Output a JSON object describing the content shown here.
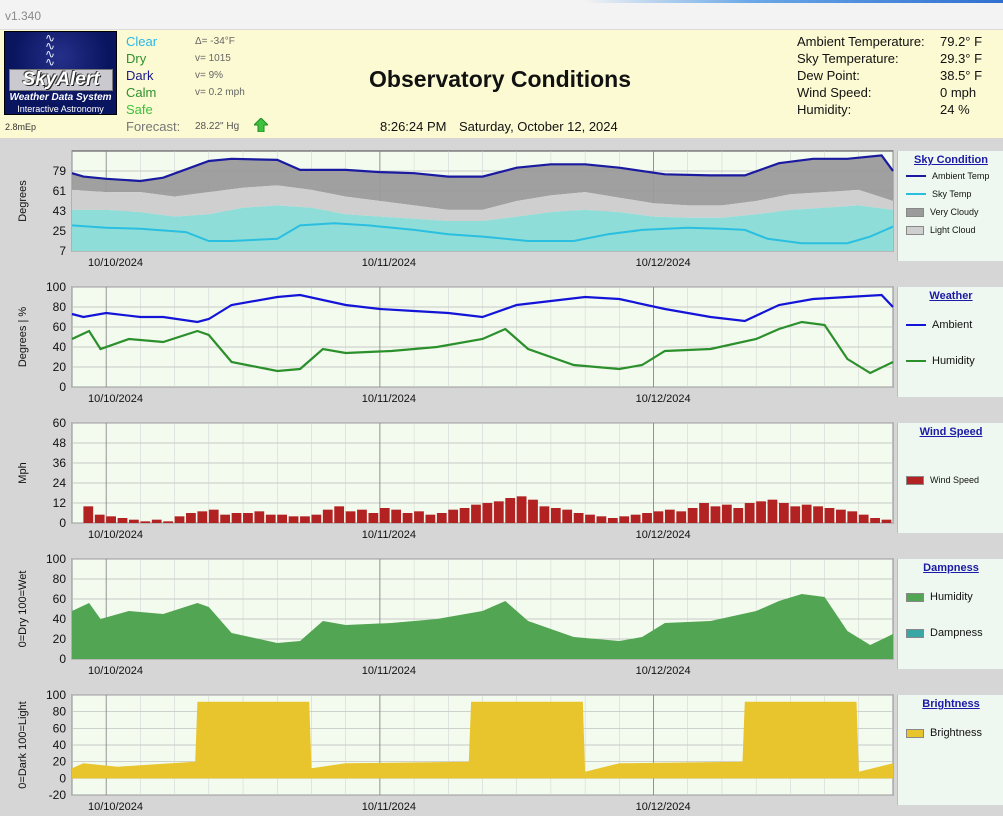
{
  "app": {
    "version": "v1.340"
  },
  "logo": {
    "brand": "SkyAlert",
    "tagline": "Weather Data System",
    "subtitle": "Interactive Astronomy",
    "caption": "2.8mEp"
  },
  "conditions": [
    {
      "label": "Clear",
      "value": "Δ= -34°F",
      "color": "#29b6e8"
    },
    {
      "label": "Dry",
      "value": "v= 1015",
      "color": "#2f8f2f"
    },
    {
      "label": "Dark",
      "value": "v= 9%",
      "color": "#1a1a8c"
    },
    {
      "label": "Calm",
      "value": "v= 0.2 mph",
      "color": "#2f8f2f"
    },
    {
      "label": "Safe",
      "value": "",
      "color": "#3fc03f"
    }
  ],
  "forecast": {
    "label": "Forecast:",
    "value": "28.22\" Hg",
    "icon": "up-arrow-icon"
  },
  "header": {
    "title": "Observatory Conditions",
    "time": "8:26:24 PM",
    "date": "Saturday, October 12, 2024"
  },
  "readouts": [
    {
      "label": "Ambient Temperature:",
      "value": "79.2° F"
    },
    {
      "label": "Sky Temperature:",
      "value": "29.3° F"
    },
    {
      "label": "Dew Point:",
      "value": "38.5° F"
    },
    {
      "label": "Wind Speed:",
      "value": "0 mph"
    },
    {
      "label": "Humidity:",
      "value": "24 %"
    }
  ],
  "chart_data": [
    {
      "type": "area",
      "id": "sky",
      "title": "Sky Condition",
      "ylabel": "Degrees",
      "yticks": [
        7,
        25,
        43,
        61,
        79
      ],
      "ylim": [
        7,
        97
      ],
      "x_dates": [
        "10/10/2024",
        "10/11/2024",
        "10/12/2024"
      ],
      "grid": true,
      "legend": "right",
      "series": [
        {
          "name": "Ambient Temp",
          "kind": "line",
          "color": "#1a1aa0",
          "x": [
            0,
            1,
            3,
            6,
            8,
            12,
            14,
            18,
            20,
            24,
            27,
            30,
            33,
            36,
            39,
            42,
            45,
            48,
            52,
            56,
            59,
            62,
            65,
            68,
            71,
            72
          ],
          "y": [
            77,
            74,
            72,
            70,
            73,
            88,
            90,
            89,
            80,
            80,
            78,
            77,
            74,
            74,
            82,
            85,
            85,
            82,
            76,
            75,
            75,
            86,
            90,
            90,
            93,
            79
          ]
        },
        {
          "name": "Sky Temp",
          "kind": "line",
          "color": "#2abfe0",
          "x": [
            0,
            3,
            6,
            10,
            12,
            14,
            18,
            20,
            23,
            26,
            30,
            33,
            36,
            40,
            44,
            47,
            50,
            54,
            57,
            59,
            61,
            64,
            68,
            70,
            72
          ],
          "y": [
            30,
            28,
            27,
            24,
            16,
            16,
            18,
            30,
            32,
            30,
            26,
            22,
            20,
            16,
            16,
            22,
            26,
            28,
            27,
            26,
            18,
            14,
            14,
            20,
            29
          ]
        },
        {
          "name": "Very Cloudy",
          "kind": "band",
          "color": "#9b9b9b",
          "x": [
            0,
            3,
            6,
            9,
            12,
            15,
            18,
            21,
            24,
            27,
            30,
            33,
            36,
            39,
            42,
            45,
            48,
            51,
            54,
            57,
            60,
            63,
            66,
            69,
            72
          ],
          "y": [
            62,
            60,
            60,
            56,
            60,
            64,
            66,
            62,
            56,
            52,
            48,
            44,
            44,
            52,
            57,
            60,
            55,
            50,
            48,
            48,
            52,
            58,
            60,
            62,
            52
          ]
        },
        {
          "name": "Light Cloud",
          "kind": "band",
          "color": "#cfcfcf",
          "x": [
            0,
            3,
            6,
            9,
            12,
            15,
            18,
            21,
            24,
            27,
            30,
            33,
            36,
            39,
            42,
            45,
            48,
            51,
            54,
            57,
            60,
            63,
            66,
            69,
            72
          ],
          "y": [
            44,
            44,
            42,
            38,
            40,
            46,
            48,
            46,
            40,
            38,
            36,
            34,
            34,
            38,
            42,
            44,
            42,
            38,
            37,
            37,
            40,
            44,
            46,
            48,
            44
          ]
        }
      ]
    },
    {
      "type": "line",
      "id": "weather",
      "title": "Weather",
      "ylabel": "Degrees | %",
      "yticks": [
        0,
        20,
        40,
        60,
        80,
        100
      ],
      "ylim": [
        0,
        100
      ],
      "x_dates": [
        "10/10/2024",
        "10/11/2024",
        "10/12/2024"
      ],
      "grid": true,
      "legend": "right",
      "series": [
        {
          "name": "Ambient",
          "color": "#1414d8",
          "x": [
            0,
            1,
            3,
            6,
            8,
            11,
            12,
            14,
            18,
            20,
            24,
            27,
            30,
            33,
            36,
            39,
            42,
            45,
            48,
            52,
            56,
            59,
            62,
            65,
            68,
            71,
            72
          ],
          "y": [
            73,
            70,
            74,
            70,
            70,
            65,
            68,
            82,
            90,
            92,
            82,
            78,
            76,
            74,
            70,
            82,
            86,
            90,
            88,
            78,
            70,
            66,
            82,
            88,
            90,
            92,
            80
          ]
        },
        {
          "name": "Humidity",
          "color": "#2b8f2b",
          "x": [
            0,
            1.5,
            2.5,
            5,
            8,
            11,
            12,
            14,
            18,
            20,
            22,
            24,
            28,
            32,
            36,
            38,
            40,
            44,
            48,
            50,
            52,
            56,
            60,
            62,
            64,
            66,
            68,
            70,
            72
          ],
          "y": [
            48,
            56,
            38,
            48,
            45,
            56,
            52,
            25,
            16,
            18,
            38,
            34,
            36,
            40,
            48,
            58,
            38,
            22,
            18,
            22,
            36,
            38,
            48,
            58,
            65,
            62,
            28,
            14,
            25
          ]
        }
      ]
    },
    {
      "type": "bar",
      "id": "wind",
      "title": "Wind Speed",
      "ylabel": "Mph",
      "yticks": [
        0,
        12,
        24,
        36,
        48,
        60
      ],
      "ylim": [
        0,
        60
      ],
      "x_dates": [
        "10/10/2024",
        "10/11/2024",
        "10/12/2024"
      ],
      "grid": true,
      "legend": "right",
      "series": [
        {
          "name": "Wind Speed",
          "color": "#b22222",
          "x": [
            0,
            1,
            2,
            3,
            4,
            5,
            6,
            7,
            8,
            9,
            10,
            11,
            12,
            13,
            14,
            15,
            16,
            17,
            18,
            19,
            20,
            21,
            22,
            23,
            24,
            25,
            26,
            27,
            28,
            29,
            30,
            31,
            32,
            33,
            34,
            35,
            36,
            37,
            38,
            39,
            40,
            41,
            42,
            43,
            44,
            45,
            46,
            47,
            48,
            49,
            50,
            51,
            52,
            53,
            54,
            55,
            56,
            57,
            58,
            59,
            60,
            61,
            62,
            63,
            64,
            65,
            66,
            67,
            68,
            69,
            70,
            71
          ],
          "y": [
            0,
            10,
            5,
            4,
            3,
            2,
            1,
            2,
            1,
            4,
            6,
            7,
            8,
            5,
            6,
            6,
            7,
            5,
            5,
            4,
            4,
            5,
            8,
            10,
            7,
            8,
            6,
            9,
            8,
            6,
            7,
            5,
            6,
            8,
            9,
            11,
            12,
            13,
            15,
            16,
            14,
            10,
            9,
            8,
            6,
            5,
            4,
            3,
            4,
            5,
            6,
            7,
            8,
            7,
            9,
            12,
            10,
            11,
            9,
            12,
            13,
            14,
            12,
            10,
            11,
            10,
            9,
            8,
            7,
            5,
            3,
            2
          ]
        }
      ]
    },
    {
      "type": "area",
      "id": "dampness",
      "title": "Dampness",
      "ylabel": "0=Dry 100=Wet",
      "yticks": [
        0,
        20,
        40,
        60,
        80,
        100
      ],
      "ylim": [
        0,
        100
      ],
      "x_dates": [
        "10/10/2024",
        "10/11/2024",
        "10/12/2024"
      ],
      "grid": true,
      "legend": "right",
      "series": [
        {
          "name": "Humidity",
          "color": "#52a552",
          "x": [
            0,
            1.5,
            2.5,
            5,
            8,
            11,
            12,
            14,
            18,
            20,
            22,
            24,
            28,
            32,
            36,
            38,
            40,
            44,
            48,
            50,
            52,
            56,
            60,
            62,
            64,
            66,
            68,
            70,
            72
          ],
          "y": [
            48,
            56,
            40,
            48,
            45,
            56,
            52,
            26,
            16,
            18,
            38,
            34,
            36,
            40,
            48,
            58,
            38,
            22,
            18,
            22,
            36,
            38,
            48,
            58,
            65,
            62,
            28,
            14,
            25
          ]
        },
        {
          "name": "Dampness",
          "color": "#3aa7a7",
          "x": [],
          "y": []
        }
      ]
    },
    {
      "type": "area",
      "id": "brightness",
      "title": "Brightness",
      "ylabel": "0=Dark 100=Light",
      "yticks": [
        -20,
        0,
        20,
        40,
        60,
        80,
        100
      ],
      "ylim": [
        -20,
        100
      ],
      "x_dates": [
        "10/10/2024",
        "10/11/2024",
        "10/12/2024"
      ],
      "grid": true,
      "legend": "right",
      "series": [
        {
          "name": "Brightness",
          "color": "#e8c52c",
          "x": [
            0,
            1,
            4,
            10.8,
            11,
            20.8,
            21,
            24,
            34.8,
            35,
            44.8,
            45,
            48,
            58.8,
            59,
            68.8,
            69,
            72
          ],
          "y": [
            12,
            18,
            14,
            20,
            92,
            92,
            12,
            18,
            20,
            92,
            92,
            8,
            18,
            20,
            92,
            92,
            8,
            18
          ]
        }
      ]
    }
  ]
}
